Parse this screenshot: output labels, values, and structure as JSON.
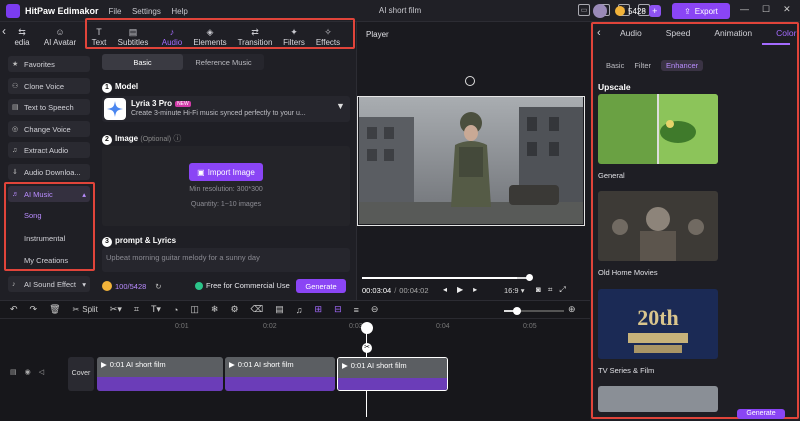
{
  "app": {
    "name": "HitPaw Edimakor",
    "menus": [
      "File",
      "Settings",
      "Help"
    ],
    "window_title": "AI short film",
    "credits": "5428",
    "export_label": "Export"
  },
  "toptabs": [
    {
      "label": "edia",
      "icon": "⇆"
    },
    {
      "label": "AI Avatar",
      "icon": "☺"
    },
    {
      "label": "Text",
      "icon": "T"
    },
    {
      "label": "Subtitles",
      "icon": "▤"
    },
    {
      "label": "Audio",
      "icon": "♪"
    },
    {
      "label": "Elements",
      "icon": "◈"
    },
    {
      "label": "Transition",
      "icon": "⇄"
    },
    {
      "label": "Filters",
      "icon": "✦"
    },
    {
      "label": "Effects",
      "icon": "✧"
    }
  ],
  "leftnav": {
    "items": [
      "Favorites",
      "Clone Voice",
      "Text to Speech",
      "Change Voice",
      "Extract Audio",
      "Audio Downloa..."
    ],
    "ai_music": "AI Music",
    "sub": [
      "Song",
      "Instrumental",
      "My Creations"
    ],
    "sound_effect": "AI Sound Effect"
  },
  "center": {
    "tabs": [
      "Basic",
      "Reference Music"
    ],
    "model_header": "Model",
    "model_name": "Lyria 3 Pro",
    "new_badge": "NEW",
    "model_desc": "Create 3-minute Hi-Fi music synced perfectly to your u...",
    "image_header": "Image",
    "optional": "(Optional)",
    "import_label": "Import Image",
    "min_res": "Min resolution: 300*300",
    "quantity": "Quantity: 1~10 images",
    "prompt_header": "prompt & Lyrics",
    "prompt_placeholder": "Upbeat morning guitar melody for a sunny day",
    "counter": "100/5428",
    "free_label": "Free for Commercial Use",
    "generate": "Generate"
  },
  "player": {
    "title": "Player",
    "time_current": "00:03:04",
    "time_total": "00:04:02",
    "ratio": "16:9",
    "progress": 0.92
  },
  "rightpanel": {
    "tabs": [
      "Audio",
      "Speed",
      "Animation",
      "Color"
    ],
    "subtabs": [
      "Basic",
      "Filter",
      "Enhancer"
    ],
    "section": "Upscale",
    "items": [
      "General",
      "Old Home Movies",
      "TV Series & Film"
    ],
    "generate": "Generate"
  },
  "timeline": {
    "split": "Split",
    "ruler": [
      "0:01",
      "0:02",
      "0:03",
      "0:04",
      "0:05"
    ],
    "cover": "Cover",
    "clips": [
      "0:01 AI short film",
      "0:01 AI short film",
      "0:01 AI short film"
    ]
  },
  "colors": {
    "accent": "#8a45f5",
    "highlight": "#e0443a",
    "bg": "#1b1b20"
  }
}
